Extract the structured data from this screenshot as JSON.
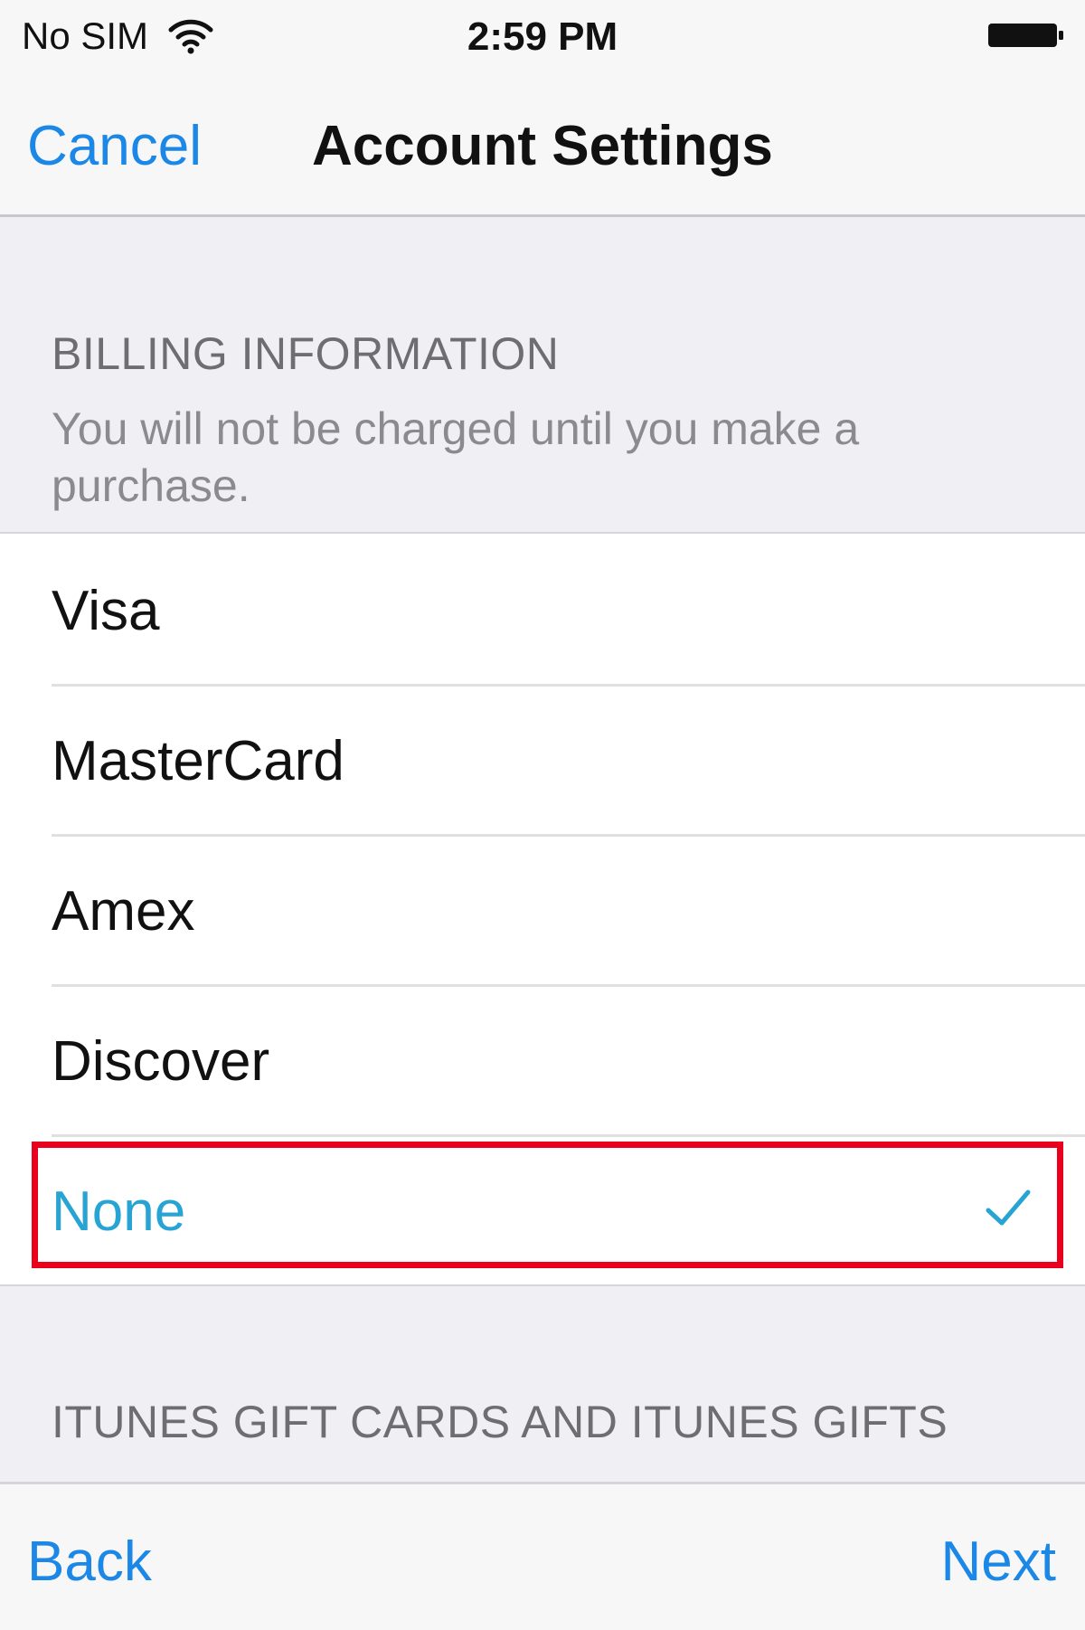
{
  "status_bar": {
    "carrier": "No SIM",
    "time": "2:59 PM",
    "wifi_icon": "wifi-icon",
    "battery_icon": "battery-full-icon"
  },
  "nav": {
    "cancel_label": "Cancel",
    "title": "Account Settings"
  },
  "billing": {
    "header": "BILLING INFORMATION",
    "note": "You will not be charged until you make a purchase.",
    "options": [
      {
        "label": "Visa",
        "selected": false
      },
      {
        "label": "MasterCard",
        "selected": false
      },
      {
        "label": "Amex",
        "selected": false
      },
      {
        "label": "Discover",
        "selected": false
      },
      {
        "label": "None",
        "selected": true
      }
    ],
    "check_icon": "checkmark-icon"
  },
  "gift_section": {
    "header": "ITUNES GIFT CARDS AND ITUNES GIFTS"
  },
  "toolbar": {
    "back_label": "Back",
    "next_label": "Next"
  },
  "colors": {
    "accent": "#1b87e6",
    "selected_text": "#27a4d4",
    "highlight": "#e8001c"
  }
}
